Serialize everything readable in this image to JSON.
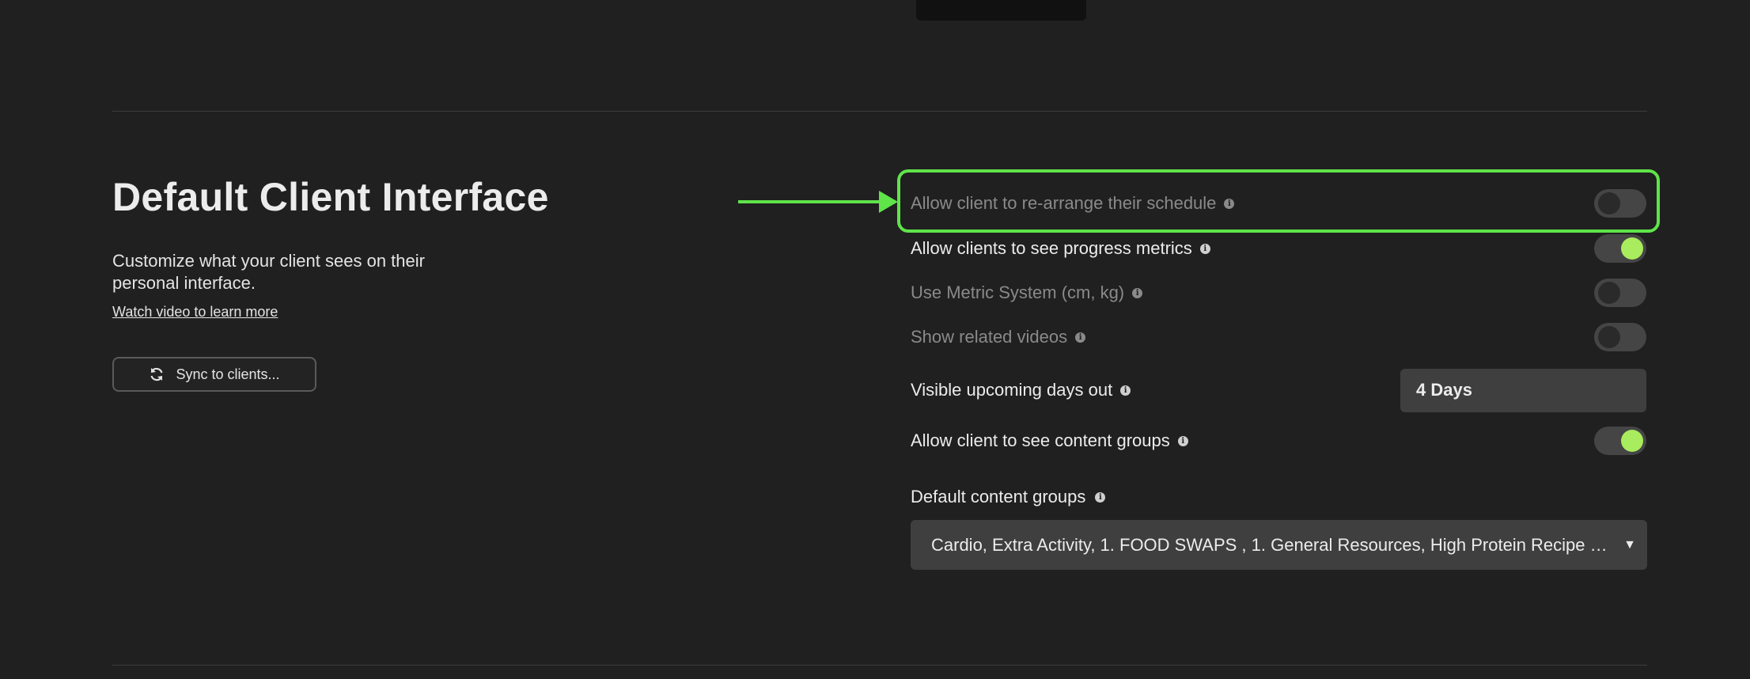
{
  "section": {
    "title": "Default Client Interface",
    "description": "Customize what your client sees on their personal interface.",
    "watch_link": "Watch video to learn more",
    "sync_button": "Sync to clients..."
  },
  "settings": {
    "rearrange": {
      "label": "Allow client to re-arrange their schedule",
      "enabled": false,
      "info": "i"
    },
    "progress": {
      "label": "Allow clients to see progress metrics",
      "enabled": true,
      "info": "i"
    },
    "metric": {
      "label": "Use Metric System (cm, kg)",
      "enabled": false,
      "info": "i"
    },
    "videos": {
      "label": "Show related videos",
      "enabled": false,
      "info": "i"
    },
    "upcoming": {
      "label": "Visible upcoming days out",
      "value": "4 Days",
      "info": "i"
    },
    "content_groups": {
      "label": "Allow client to see content groups",
      "enabled": true,
      "info": "i"
    },
    "default_groups": {
      "label": "Default content groups",
      "value": "Cardio, Extra Activity, 1. FOOD SWAPS , 1. General Resources, High Protein Recipe B…",
      "info": "i"
    }
  },
  "colors": {
    "background": "#202020",
    "accent_green": "#5fe44a",
    "toggle_on": "#a9ec5e"
  },
  "icons": {
    "sync": "sync-icon",
    "info": "info-icon",
    "caret": "chevron-down-icon"
  }
}
